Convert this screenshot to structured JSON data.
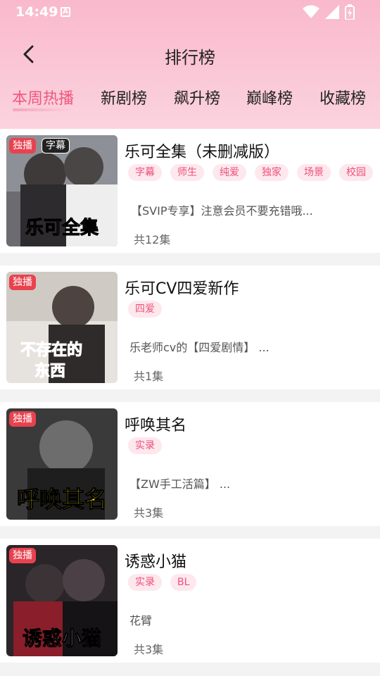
{
  "status_bar": {
    "time": "14:49",
    "a_label": "A"
  },
  "header": {
    "title": "排行榜"
  },
  "tabs": [
    {
      "label": "本周热播",
      "active": true
    },
    {
      "label": "新剧榜"
    },
    {
      "label": "飙升榜"
    },
    {
      "label": "巅峰榜"
    },
    {
      "label": "收藏榜"
    }
  ],
  "items": [
    {
      "title": "乐可全集（未删减版）",
      "badge_exclusive": "独播",
      "badge_subtitle": "字幕",
      "cover_text": "乐可全集",
      "tags": [
        "字幕",
        "师生",
        "纯爱",
        "独家",
        "场景",
        "校园"
      ],
      "desc": "【SVIP专享】注意会员不要充错哦...",
      "count": "共12集"
    },
    {
      "title": "乐可CV四爱新作",
      "badge_exclusive": "独播",
      "cover_text": "不存在的东西",
      "tags": [
        "四爱"
      ],
      "desc": "乐老师cv的【四爱剧情】 ...",
      "count": "共1集"
    },
    {
      "title": "呼唤其名",
      "badge_exclusive": "独播",
      "cover_text": "呼唤其名",
      "tags": [
        "实录"
      ],
      "desc": "【ZW手工活篇】 ...",
      "count": "共3集"
    },
    {
      "title": "诱惑小猫",
      "badge_exclusive": "独播",
      "cover_text": "诱惑小猫",
      "tags": [
        "实录",
        "BL"
      ],
      "desc": "花臂",
      "count": "共3集"
    }
  ],
  "colors": {
    "accent": "#f0577f",
    "header_bg": "#f9b9cc",
    "tag_bg": "#fde8ee",
    "badge": "#e8424f"
  }
}
